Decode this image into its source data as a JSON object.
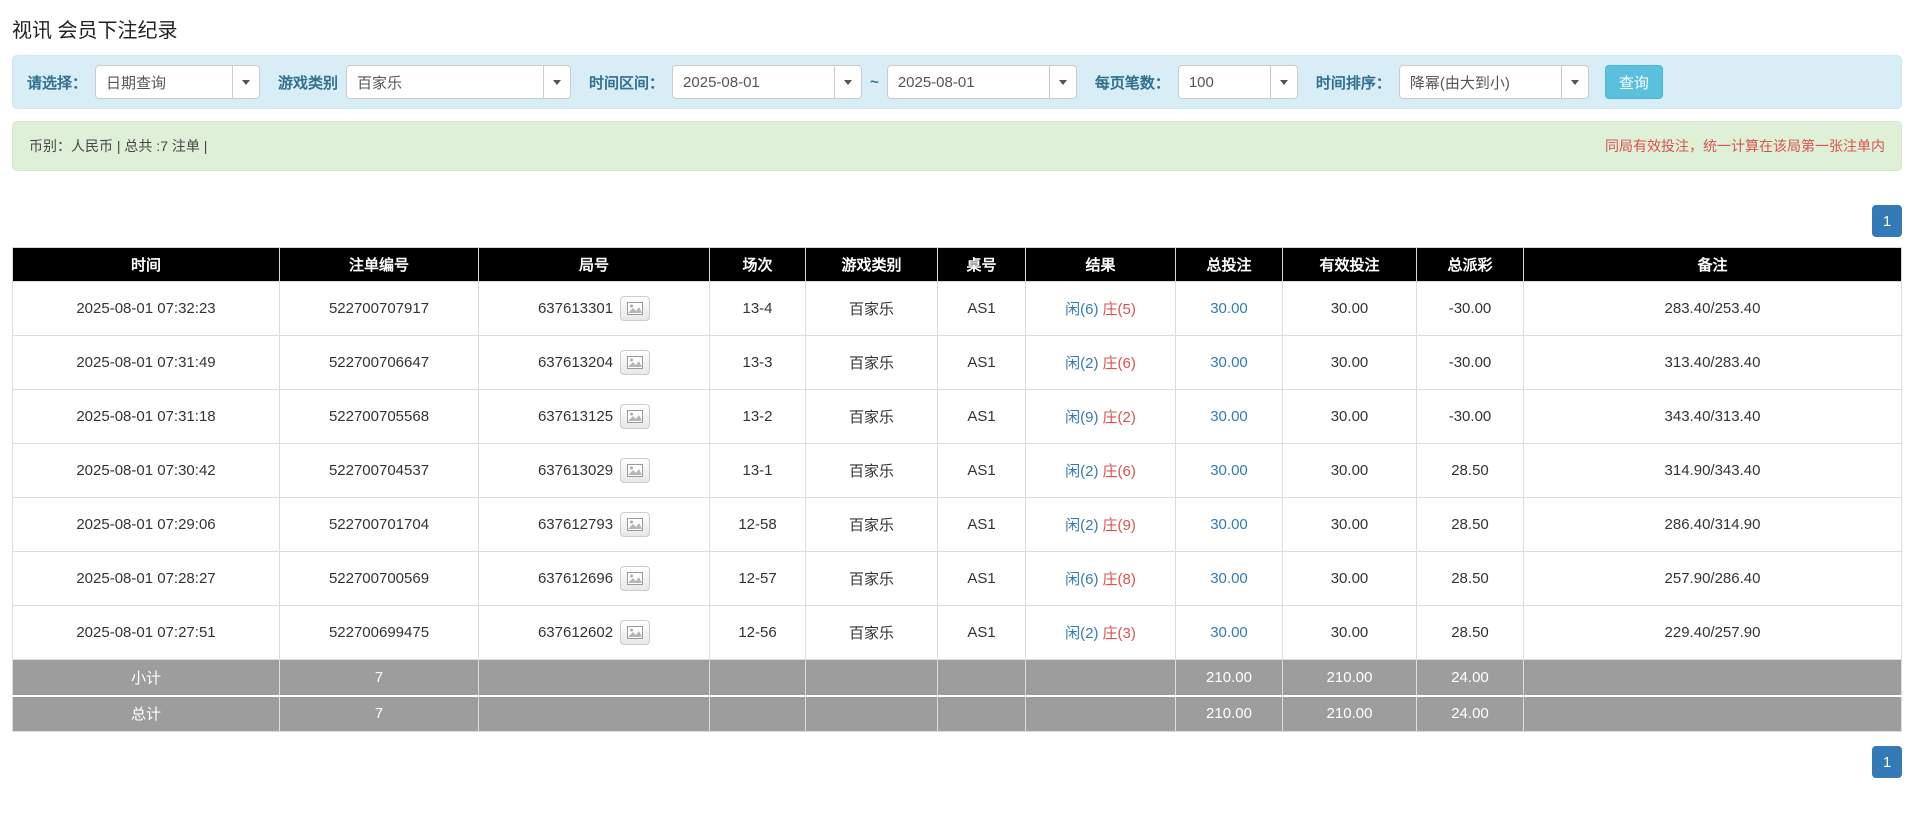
{
  "page": {
    "title": "视讯 会员下注纪录"
  },
  "filters": {
    "select": {
      "label": "请选择：",
      "value": "日期查询"
    },
    "game_type": {
      "label": "游戏类别",
      "value": "百家乐"
    },
    "time_range": {
      "label": "时间区间：",
      "from": "2025-08-01",
      "separator": "~",
      "to": "2025-08-01"
    },
    "page_size": {
      "label": "每页笔数：",
      "value": "100"
    },
    "sort": {
      "label": "时间排序：",
      "value": "降幂(由大到小)"
    },
    "search_button": "查询"
  },
  "summary": {
    "currency_info": "币别：人民币 | 总共 :7 注单 |",
    "notice": "同局有效投注，统一计算在该局第一张注单内"
  },
  "pagination": {
    "current_page": "1"
  },
  "table": {
    "headers": [
      "时间",
      "注单编号",
      "局号",
      "场次",
      "游戏类别",
      "桌号",
      "结果",
      "总投注",
      "有效投注",
      "总派彩",
      "备注"
    ],
    "rows": [
      {
        "time": "2025-08-01 07:32:23",
        "bet_no": "522700707917",
        "round_no": "637613301",
        "session": "13-4",
        "game_type": "百家乐",
        "table_no": "AS1",
        "result_player": "闲(6)",
        "result_banker": "庄(5)",
        "total_bet": "30.00",
        "valid_bet": "30.00",
        "total_payout": "-30.00",
        "remark": "283.40/253.40"
      },
      {
        "time": "2025-08-01 07:31:49",
        "bet_no": "522700706647",
        "round_no": "637613204",
        "session": "13-3",
        "game_type": "百家乐",
        "table_no": "AS1",
        "result_player": "闲(2)",
        "result_banker": "庄(6)",
        "total_bet": "30.00",
        "valid_bet": "30.00",
        "total_payout": "-30.00",
        "remark": "313.40/283.40"
      },
      {
        "time": "2025-08-01 07:31:18",
        "bet_no": "522700705568",
        "round_no": "637613125",
        "session": "13-2",
        "game_type": "百家乐",
        "table_no": "AS1",
        "result_player": "闲(9)",
        "result_banker": "庄(2)",
        "total_bet": "30.00",
        "valid_bet": "30.00",
        "total_payout": "-30.00",
        "remark": "343.40/313.40"
      },
      {
        "time": "2025-08-01 07:30:42",
        "bet_no": "522700704537",
        "round_no": "637613029",
        "session": "13-1",
        "game_type": "百家乐",
        "table_no": "AS1",
        "result_player": "闲(2)",
        "result_banker": "庄(6)",
        "total_bet": "30.00",
        "valid_bet": "30.00",
        "total_payout": "28.50",
        "remark": "314.90/343.40"
      },
      {
        "time": "2025-08-01 07:29:06",
        "bet_no": "522700701704",
        "round_no": "637612793",
        "session": "12-58",
        "game_type": "百家乐",
        "table_no": "AS1",
        "result_player": "闲(2)",
        "result_banker": "庄(9)",
        "total_bet": "30.00",
        "valid_bet": "30.00",
        "total_payout": "28.50",
        "remark": "286.40/314.90"
      },
      {
        "time": "2025-08-01 07:28:27",
        "bet_no": "522700700569",
        "round_no": "637612696",
        "session": "12-57",
        "game_type": "百家乐",
        "table_no": "AS1",
        "result_player": "闲(6)",
        "result_banker": "庄(8)",
        "total_bet": "30.00",
        "valid_bet": "30.00",
        "total_payout": "28.50",
        "remark": "257.90/286.40"
      },
      {
        "time": "2025-08-01 07:27:51",
        "bet_no": "522700699475",
        "round_no": "637612602",
        "session": "12-56",
        "game_type": "百家乐",
        "table_no": "AS1",
        "result_player": "闲(2)",
        "result_banker": "庄(3)",
        "total_bet": "30.00",
        "valid_bet": "30.00",
        "total_payout": "28.50",
        "remark": "229.40/257.90"
      }
    ],
    "subtotal": {
      "label": "小计",
      "count": "7",
      "total_bet": "210.00",
      "valid_bet": "210.00",
      "total_payout": "24.00"
    },
    "total": {
      "label": "总计",
      "count": "7",
      "total_bet": "210.00",
      "valid_bet": "210.00",
      "total_payout": "24.00"
    }
  },
  "colors": {
    "accent_blue": "#337ab7",
    "negative_red": "#d9534f",
    "player_blue": "#337ab7",
    "banker_red": "#d9534f",
    "filter_bar_bg": "#d9edf7",
    "filter_label": "#31708f",
    "summary_bar_bg": "#dff0d8",
    "table_header_bg": "#000000",
    "footer_row_bg": "#9d9d9d",
    "search_button_bg": "#5bc0de"
  },
  "icons": {
    "caret_down_icon": "▼",
    "image_icon": "picture-glyph"
  }
}
